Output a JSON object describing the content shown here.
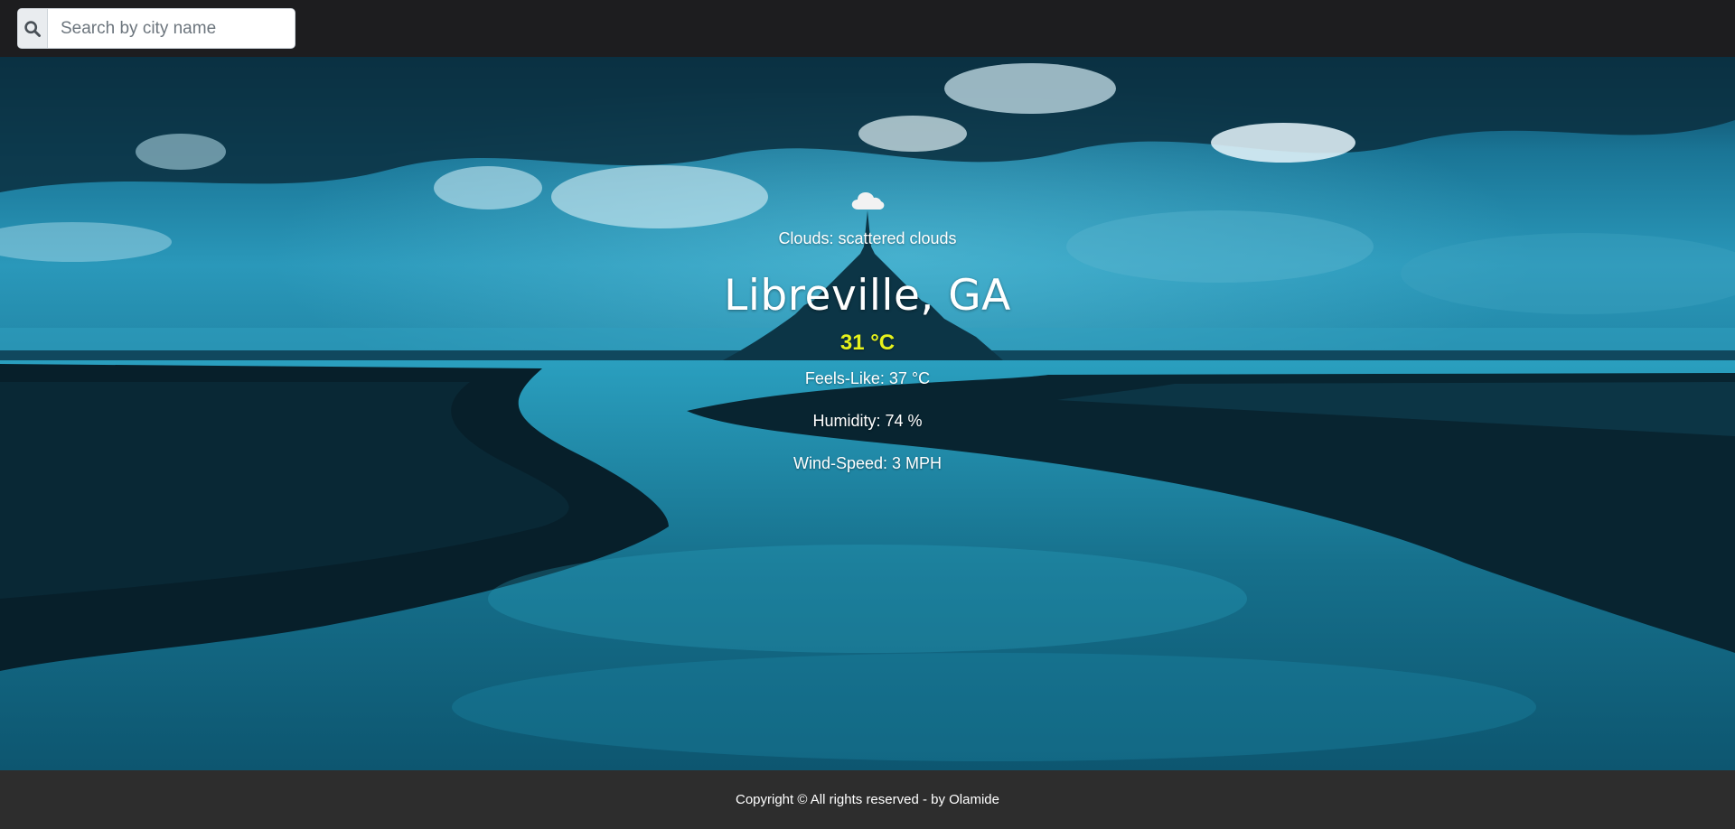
{
  "search": {
    "placeholder": "Search by city name",
    "value": ""
  },
  "weather": {
    "icon": "cloud-icon",
    "condition": "Clouds: scattered clouds",
    "city": "Libreville, GA",
    "temperature": "31 °C",
    "feels_like": "Feels-Like: 37 °C",
    "humidity": "Humidity: 74 %",
    "wind_speed": "Wind-Speed: 3 MPH"
  },
  "footer": {
    "text": "Copyright © All rights reserved - by Olamide"
  },
  "colors": {
    "navbar": "#1d1d1f",
    "footer": "#2d2d2d",
    "temperature": "#e6f21c"
  }
}
